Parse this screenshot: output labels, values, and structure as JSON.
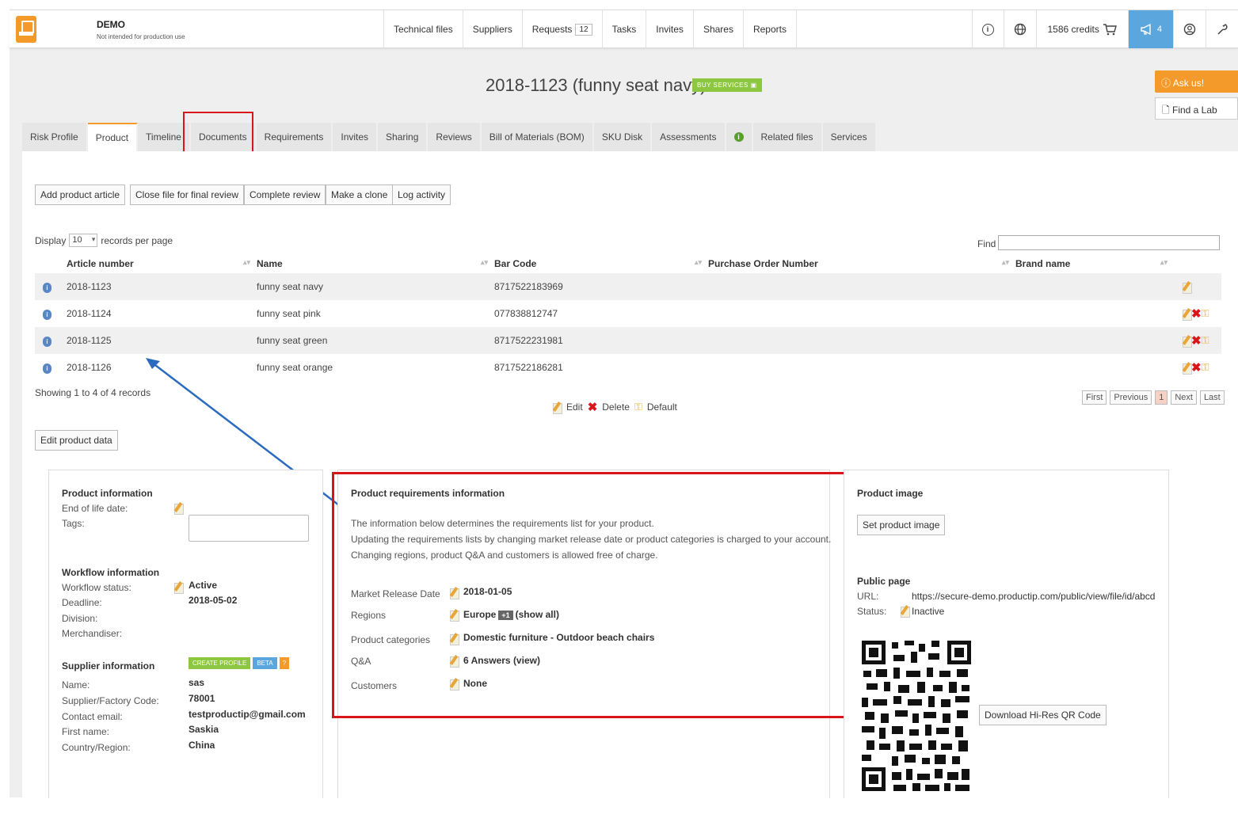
{
  "app": {
    "title": "DEMO",
    "subtitle": "Not intended for production use"
  },
  "nav": {
    "items": [
      "Technical files",
      "Suppliers",
      "Requests",
      "Tasks",
      "Invites",
      "Shares",
      "Reports"
    ],
    "requests_badge": "12",
    "credits": "1586 credits",
    "notifications": "4"
  },
  "page": {
    "title": "2018-1123 (funny seat navy)",
    "buy_services": "BUY SERVICES",
    "ask_us": "Ask us!",
    "find_lab": "Find a Lab"
  },
  "tabs": [
    "Risk Profile",
    "Product",
    "Timeline",
    "Documents",
    "Requirements",
    "Invites",
    "Sharing",
    "Reviews",
    "Bill of Materials (BOM)",
    "SKU Disk",
    "Assessments",
    "",
    "Related files",
    "Services"
  ],
  "actions": {
    "add_article": "Add product article",
    "close_file": "Close file for final review",
    "complete_review": "Complete review",
    "make_clone": "Make a clone",
    "log_activity": "Log activity",
    "edit_product": "Edit product data"
  },
  "table": {
    "display_label": "Display",
    "per_page": "10",
    "per_page_suffix": "records per page",
    "find_label": "Find",
    "columns": [
      "Article number",
      "Name",
      "Bar Code",
      "Purchase Order Number",
      "Brand name"
    ],
    "rows": [
      {
        "article": "2018-1123",
        "name": "funny seat navy",
        "barcode": "8717522183969",
        "po": "",
        "brand": ""
      },
      {
        "article": "2018-1124",
        "name": "funny seat pink",
        "barcode": "077838812747",
        "po": "",
        "brand": ""
      },
      {
        "article": "2018-1125",
        "name": "funny seat green",
        "barcode": "8717522231981",
        "po": "",
        "brand": ""
      },
      {
        "article": "2018-1126",
        "name": "funny seat orange",
        "barcode": "8717522186281",
        "po": "",
        "brand": ""
      }
    ],
    "showing": "Showing 1 to 4 of 4 records",
    "legend_edit": "Edit",
    "legend_delete": "Delete",
    "legend_default": "Default",
    "pager": [
      "First",
      "Previous",
      "1",
      "Next",
      "Last"
    ]
  },
  "product_info": {
    "heading": "Product information",
    "end_of_life_label": "End of life date:",
    "tags_label": "Tags:",
    "workflow_heading": "Workflow information",
    "workflow_status_label": "Workflow status:",
    "workflow_status": "Active",
    "deadline_label": "Deadline:",
    "deadline": "2018-05-02",
    "division_label": "Division:",
    "merchandiser_label": "Merchandiser:",
    "supplier_heading": "Supplier information",
    "create_profile": "CREATE PROFILE",
    "beta": "BETA",
    "help": "?",
    "name_label": "Name:",
    "name": "sas",
    "code_label": "Supplier/Factory Code:",
    "code": "78001",
    "email_label": "Contact email:",
    "email": "testproductip@gmail.com",
    "first_name_label": "First name:",
    "first_name": "Saskia",
    "country_label": "Country/Region:",
    "country": "China"
  },
  "requirements": {
    "heading": "Product requirements information",
    "desc1": "The information below determines the requirements list for your product.",
    "desc2": "Updating the requirements lists by changing market release date or product categories is charged to your account.",
    "desc3": "Changing regions, product Q&A and customers is allowed free of charge.",
    "release_label": "Market Release Date",
    "release": "2018-01-05",
    "regions_label": "Regions",
    "regions": "Europe",
    "regions_more": "+1",
    "regions_show": "(show all)",
    "categories_label": "Product categories",
    "categories": "Domestic furniture - Outdoor beach chairs",
    "qa_label": "Q&A",
    "qa": "6 Answers",
    "qa_view": "(view)",
    "customers_label": "Customers",
    "customers": "None"
  },
  "product_image": {
    "heading": "Product image",
    "set_image": "Set product image",
    "public_heading": "Public page",
    "url_label": "URL:",
    "url": "https://secure-demo.productip.com/public/view/file/id/abcd",
    "status_label": "Status:",
    "status": "Inactive",
    "download_qr": "Download Hi-Res QR Code"
  }
}
